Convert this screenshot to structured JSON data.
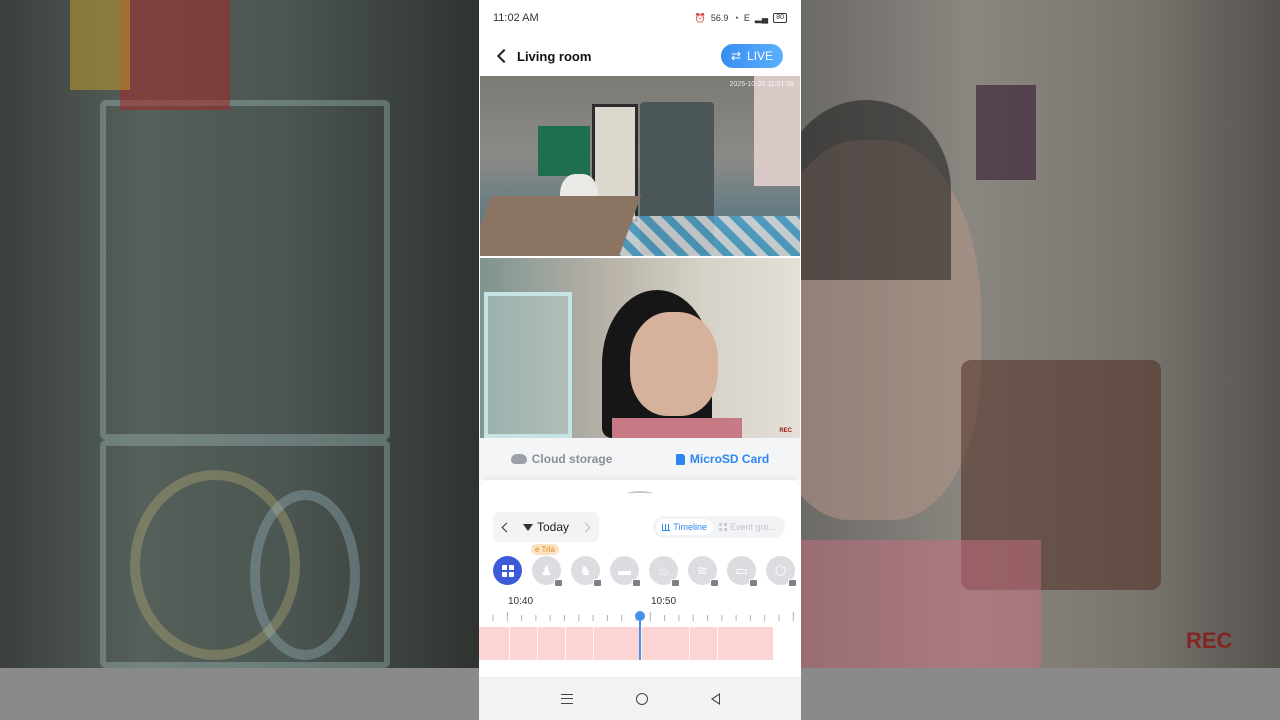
{
  "status_bar": {
    "time": "11:02 AM",
    "network_speed": "56.9",
    "network_type": "E",
    "battery": "80"
  },
  "header": {
    "title": "Living room",
    "live_label": "LIVE"
  },
  "feeds": {
    "timestamp": "2025-10-20 11:01:58",
    "rec_label": "REC"
  },
  "storage_tabs": {
    "cloud": "Cloud storage",
    "sd": "MicroSD Card",
    "active": "sd"
  },
  "date_nav": {
    "label": "Today"
  },
  "view_toggle": {
    "timeline": "Timeline",
    "events": "Event gro..."
  },
  "filters": {
    "trial_badge": "e Tria",
    "items": [
      "all",
      "person",
      "pet",
      "vehicle",
      "fire",
      "smoke",
      "sound",
      "package"
    ]
  },
  "timeline": {
    "labels": [
      "10:40",
      "10:50"
    ]
  },
  "background": {
    "rec_label": "REC"
  },
  "colors": {
    "accent": "#2f86f0",
    "event_fill": "#fcd4d4",
    "filter_active": "#3d5bd9",
    "cursor": "#4a8fe8"
  }
}
